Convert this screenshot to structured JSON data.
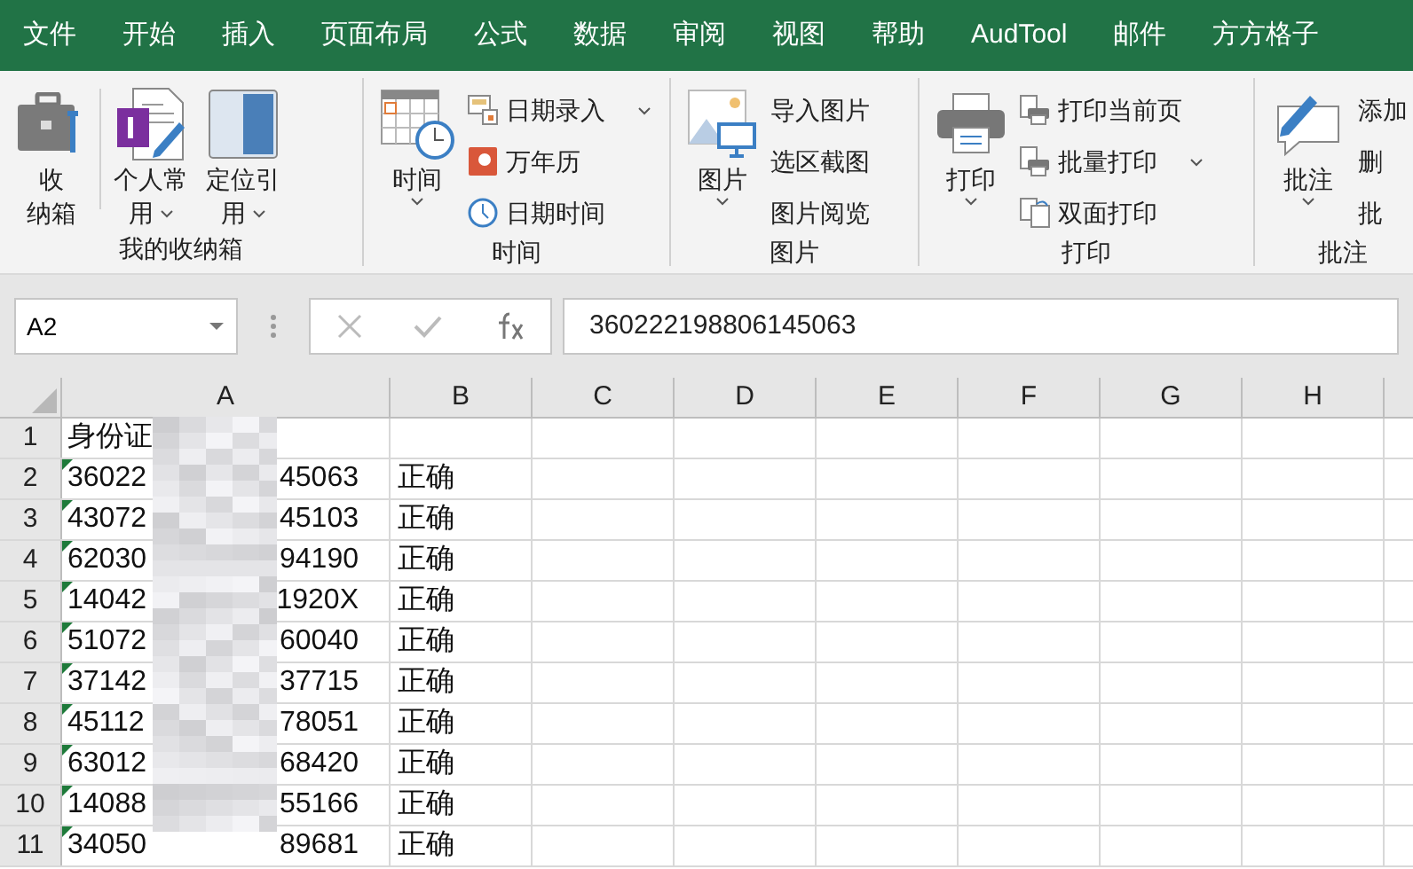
{
  "tabs": [
    {
      "label": "文件"
    },
    {
      "label": "开始"
    },
    {
      "label": "插入"
    },
    {
      "label": "页面布局"
    },
    {
      "label": "公式"
    },
    {
      "label": "数据"
    },
    {
      "label": "审阅"
    },
    {
      "label": "视图"
    },
    {
      "label": "帮助"
    },
    {
      "label": "AudTool"
    },
    {
      "label": "邮件"
    },
    {
      "label": "方方格子"
    }
  ],
  "ribbon": {
    "groups": [
      {
        "label": "我的收纳箱",
        "items": [
          {
            "kind": "large",
            "lines": [
              "收",
              "纳箱"
            ],
            "dropdown": false
          },
          {
            "kind": "divider"
          },
          {
            "kind": "large",
            "lines": [
              "个人常",
              "用"
            ],
            "dropdown": true
          },
          {
            "kind": "large",
            "lines": [
              "定位引",
              "用"
            ],
            "dropdown": true
          }
        ]
      },
      {
        "label": "时间",
        "items": [
          {
            "kind": "large",
            "lines": [
              "时间"
            ],
            "dropdown": true
          },
          {
            "kind": "stack",
            "entries": [
              {
                "label": "日期录入",
                "dropdown": true
              },
              {
                "label": "万年历",
                "dropdown": false
              },
              {
                "label": "日期时间",
                "dropdown": false
              }
            ]
          }
        ]
      },
      {
        "label": "图片",
        "items": [
          {
            "kind": "large",
            "lines": [
              "图片"
            ],
            "dropdown": true
          },
          {
            "kind": "stack",
            "entries": [
              {
                "label": "导入图片",
                "dropdown": false
              },
              {
                "label": "选区截图",
                "dropdown": false
              },
              {
                "label": "图片阅览",
                "dropdown": false
              }
            ]
          }
        ]
      },
      {
        "label": "打印",
        "items": [
          {
            "kind": "large",
            "lines": [
              "打印"
            ],
            "dropdown": true
          },
          {
            "kind": "stack",
            "entries": [
              {
                "label": "打印当前页",
                "dropdown": false
              },
              {
                "label": "批量打印",
                "dropdown": true
              },
              {
                "label": "双面打印",
                "dropdown": false
              }
            ]
          }
        ]
      },
      {
        "label": "批注",
        "items": [
          {
            "kind": "large",
            "lines": [
              "批注"
            ],
            "dropdown": true
          },
          {
            "kind": "stack",
            "entries": [
              {
                "label": "添加",
                "dropdown": false
              },
              {
                "label": "删",
                "dropdown": false
              },
              {
                "label": "批",
                "dropdown": false
              }
            ]
          }
        ]
      }
    ]
  },
  "formula_bar": {
    "name_box": "A2",
    "formula": "360222198806145063"
  },
  "sheet": {
    "columns": [
      "A",
      "B",
      "C",
      "D",
      "E",
      "F",
      "G",
      "H"
    ],
    "rows": [
      {
        "number": "1",
        "a_start": "身份证",
        "flagged": false
      },
      {
        "number": "2",
        "a_start": "36022",
        "a_end": "45063",
        "b": "正确",
        "flagged": true
      },
      {
        "number": "3",
        "a_start": "43072",
        "a_end": "45103",
        "b": "正确",
        "flagged": true
      },
      {
        "number": "4",
        "a_start": "62030",
        "a_end": "94190",
        "b": "正确",
        "flagged": true
      },
      {
        "number": "5",
        "a_start": "14042",
        "a_end": "1920X",
        "b": "正确",
        "flagged": true
      },
      {
        "number": "6",
        "a_start": "51072",
        "a_end": "60040",
        "b": "正确",
        "flagged": true
      },
      {
        "number": "7",
        "a_start": "37142",
        "a_end": "37715",
        "b": "正确",
        "flagged": true
      },
      {
        "number": "8",
        "a_start": "45112",
        "a_end": "78051",
        "b": "正确",
        "flagged": true
      },
      {
        "number": "9",
        "a_start": "63012",
        "a_end": "68420",
        "b": "正确",
        "flagged": true
      },
      {
        "number": "10",
        "a_start": "14088",
        "a_end": "55166",
        "b": "正确",
        "flagged": true
      },
      {
        "number": "11",
        "a_start": "34050",
        "a_end": "89681",
        "b": "正确",
        "flagged": true
      }
    ]
  }
}
